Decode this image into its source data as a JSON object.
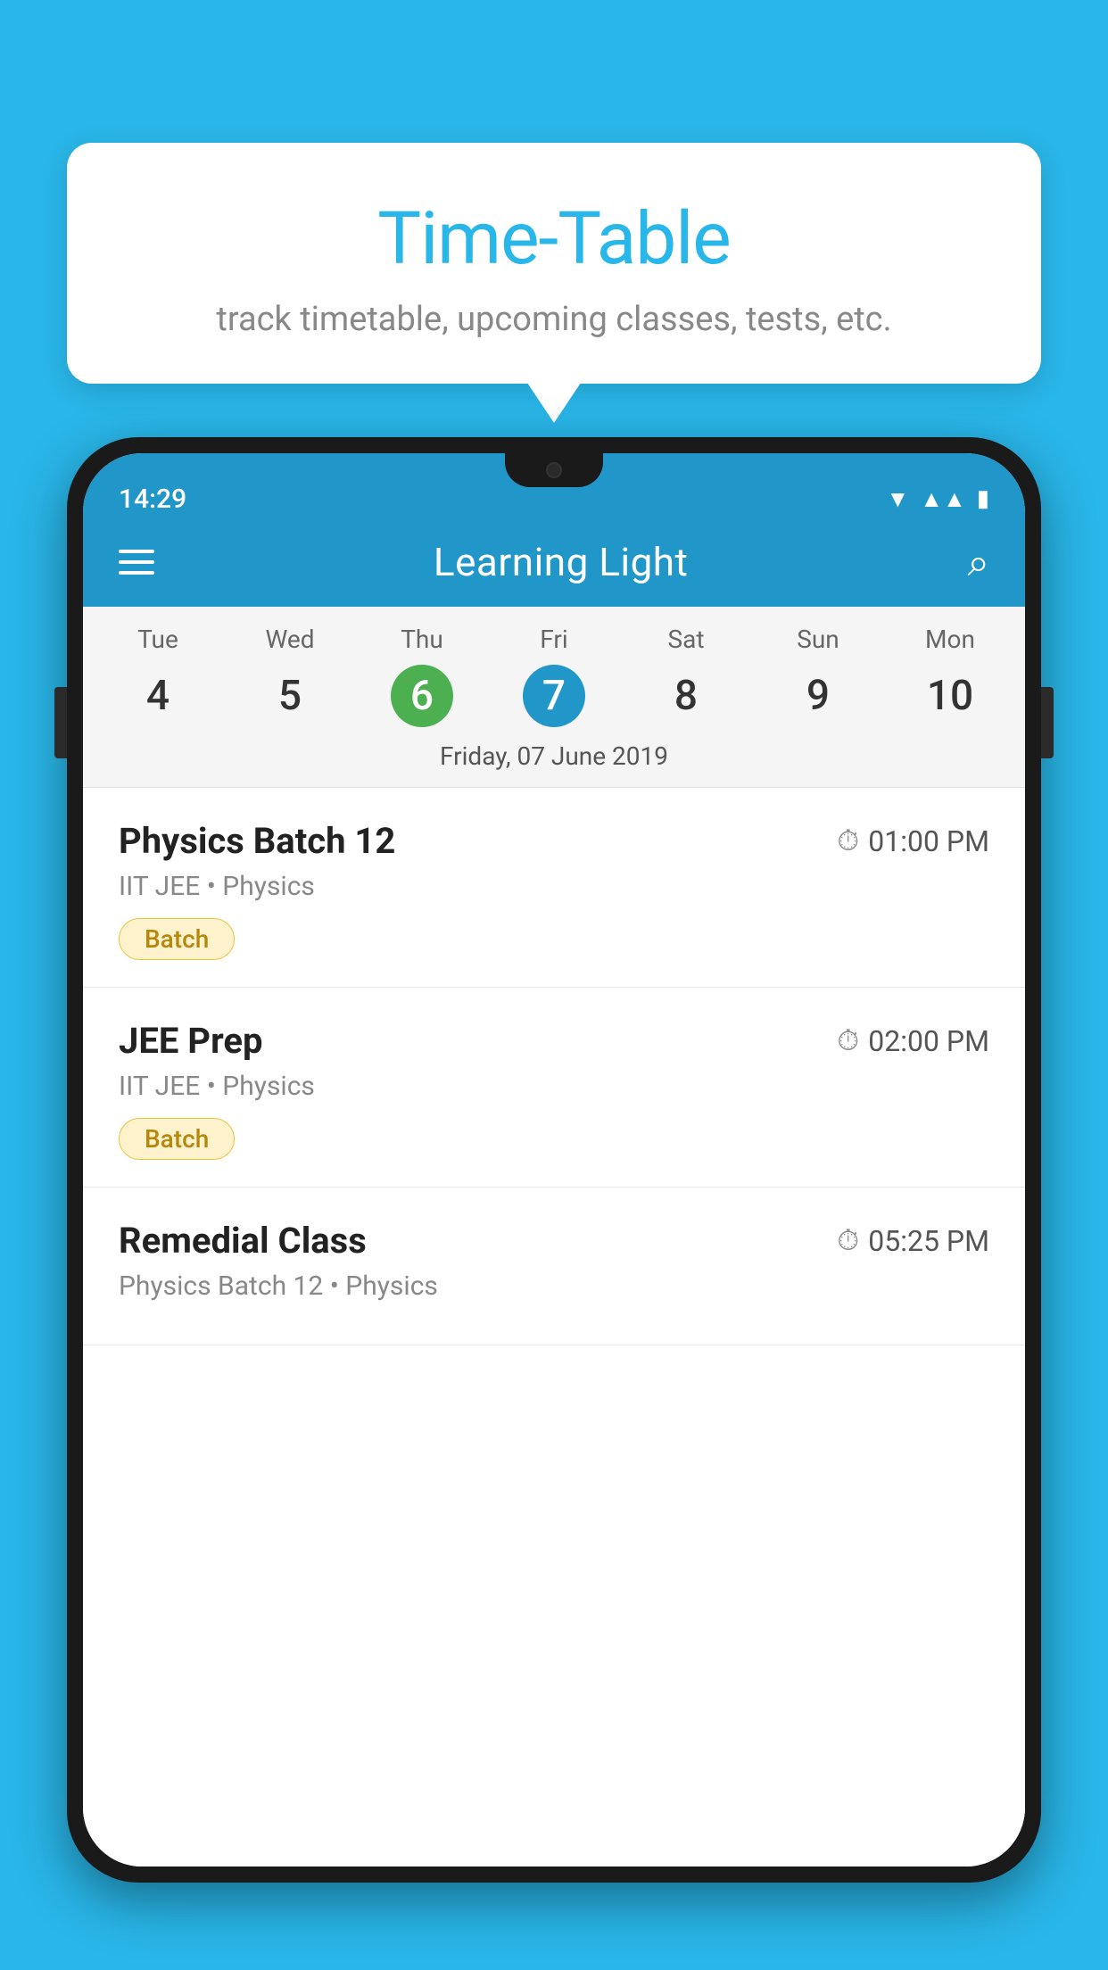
{
  "background_color": "#29B6E8",
  "tooltip": {
    "title": "Time-Table",
    "subtitle": "track timetable, upcoming classes, tests, etc."
  },
  "phone": {
    "status_bar": {
      "time": "14:29"
    },
    "app_bar": {
      "title": "Learning Light"
    },
    "calendar": {
      "days": [
        {
          "name": "Tue",
          "num": "4",
          "state": "normal"
        },
        {
          "name": "Wed",
          "num": "5",
          "state": "normal"
        },
        {
          "name": "Thu",
          "num": "6",
          "state": "today"
        },
        {
          "name": "Fri",
          "num": "7",
          "state": "selected"
        },
        {
          "name": "Sat",
          "num": "8",
          "state": "normal"
        },
        {
          "name": "Sun",
          "num": "9",
          "state": "normal"
        },
        {
          "name": "Mon",
          "num": "10",
          "state": "normal"
        }
      ],
      "selected_date_label": "Friday, 07 June 2019"
    },
    "schedule": [
      {
        "title": "Physics Batch 12",
        "time": "01:00 PM",
        "subtitle": "IIT JEE • Physics",
        "badge": "Batch"
      },
      {
        "title": "JEE Prep",
        "time": "02:00 PM",
        "subtitle": "IIT JEE • Physics",
        "badge": "Batch"
      },
      {
        "title": "Remedial Class",
        "time": "05:25 PM",
        "subtitle": "Physics Batch 12 • Physics",
        "badge": null
      }
    ]
  }
}
